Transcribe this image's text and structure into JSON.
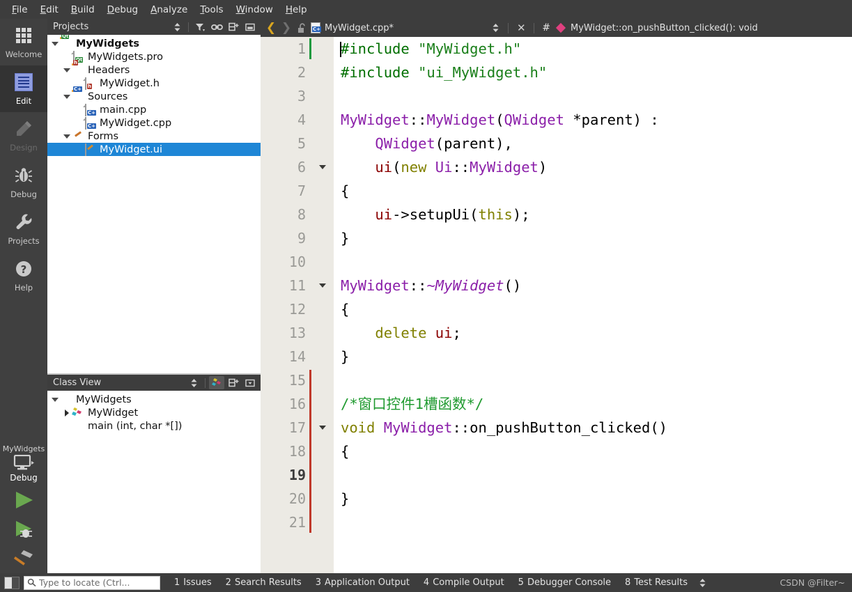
{
  "menubar": {
    "items": [
      {
        "label": "File",
        "mnemonic": "F"
      },
      {
        "label": "Edit",
        "mnemonic": "E"
      },
      {
        "label": "Build",
        "mnemonic": "B"
      },
      {
        "label": "Debug",
        "mnemonic": "D"
      },
      {
        "label": "Analyze",
        "mnemonic": "A"
      },
      {
        "label": "Tools",
        "mnemonic": "T"
      },
      {
        "label": "Window",
        "mnemonic": "W"
      },
      {
        "label": "Help",
        "mnemonic": "H"
      }
    ]
  },
  "modebar": {
    "modes": [
      {
        "label": "Welcome",
        "icon": "grid-icon",
        "state": "normal"
      },
      {
        "label": "Edit",
        "icon": "document-icon",
        "state": "active"
      },
      {
        "label": "Design",
        "icon": "pencil-icon",
        "state": "disabled"
      },
      {
        "label": "Debug",
        "icon": "bug-icon",
        "state": "normal"
      },
      {
        "label": "Projects",
        "icon": "wrench-icon",
        "state": "normal"
      },
      {
        "label": "Help",
        "icon": "question-mark-icon",
        "state": "normal"
      }
    ],
    "kit_selector": {
      "project": "MyWidgets",
      "build_config": "Debug",
      "icon": "monitor-icon"
    },
    "actions": [
      {
        "name": "run-button",
        "icon": "play-icon"
      },
      {
        "name": "debug-button",
        "icon": "play-bug-icon"
      },
      {
        "name": "build-button",
        "icon": "hammer-icon"
      }
    ]
  },
  "projects_panel": {
    "title": "Projects",
    "toolbar": [
      {
        "name": "sync-dropdown",
        "icon": "updown-arrows-icon"
      },
      {
        "name": "filter-tree-button",
        "icon": "funnel-icon"
      },
      {
        "name": "link-with-editor-button",
        "icon": "link-icon"
      },
      {
        "name": "split-button",
        "icon": "split-plus-icon"
      },
      {
        "name": "close-panel-button",
        "icon": "minimize-icon"
      }
    ],
    "tree": [
      {
        "label": "MyWidgets",
        "depth": 0,
        "expander": "down",
        "icon": "qt-project-folder-icon",
        "bold": true,
        "selected": false
      },
      {
        "label": "MyWidgets.pro",
        "depth": 1,
        "expander": "none",
        "icon": "qt-pro-file-icon",
        "bold": false,
        "selected": false
      },
      {
        "label": "Headers",
        "depth": 1,
        "expander": "down",
        "icon": "headers-folder-icon",
        "bold": false,
        "selected": false
      },
      {
        "label": "MyWidget.h",
        "depth": 2,
        "expander": "none",
        "icon": "header-file-icon",
        "bold": false,
        "selected": false
      },
      {
        "label": "Sources",
        "depth": 1,
        "expander": "down",
        "icon": "sources-folder-icon",
        "bold": false,
        "selected": false
      },
      {
        "label": "main.cpp",
        "depth": 2,
        "expander": "none",
        "icon": "cpp-file-icon",
        "bold": false,
        "selected": false
      },
      {
        "label": "MyWidget.cpp",
        "depth": 2,
        "expander": "none",
        "icon": "cpp-file-icon",
        "bold": false,
        "selected": false
      },
      {
        "label": "Forms",
        "depth": 1,
        "expander": "down",
        "icon": "forms-folder-icon",
        "bold": false,
        "selected": false
      },
      {
        "label": "MyWidget.ui",
        "depth": 2,
        "expander": "none",
        "icon": "ui-file-icon",
        "bold": false,
        "selected": true
      }
    ]
  },
  "class_view_panel": {
    "title": "Class View",
    "toolbar": [
      {
        "name": "sync-dropdown",
        "icon": "updown-arrows-icon"
      },
      {
        "name": "show-subprojects-button",
        "icon": "class-filter-icon",
        "active": true
      },
      {
        "name": "split-button",
        "icon": "split-plus-icon"
      },
      {
        "name": "panel-menu-button",
        "icon": "dropdown-box-icon"
      }
    ],
    "tree": [
      {
        "label": "MyWidgets",
        "depth": 0,
        "expander": "down",
        "icon": "project-folder-icon"
      },
      {
        "label": "MyWidget",
        "depth": 1,
        "expander": "right",
        "icon": "class-icon"
      },
      {
        "label": "main (int, char *[])",
        "depth": 1,
        "expander": "none",
        "icon": "function-diamond-icon"
      }
    ]
  },
  "editor": {
    "toolbar": {
      "back_icon": "chevron-left-icon",
      "forward_icon": "chevron-right-icon",
      "lock_icon": "unlocked-padlock-icon",
      "file_icon": "cpp-file-icon",
      "filename": "MyWidget.cpp*",
      "dropdown_icon": "updown-arrows-icon",
      "close_icon": "close-icon",
      "hash_icon": "#",
      "symbol_icon": "function-diamond-icon",
      "symbol": "MyWidget::on_pushButton_clicked(): void"
    },
    "current_line": 19,
    "lines": [
      {
        "n": 1,
        "fold": false,
        "mark": "green",
        "tokens": [
          {
            "t": "#include ",
            "c": "pp"
          },
          {
            "t": "\"MyWidget.h\"",
            "c": "st"
          }
        ]
      },
      {
        "n": 2,
        "fold": false,
        "mark": "none",
        "tokens": [
          {
            "t": "#include ",
            "c": "pp"
          },
          {
            "t": "\"ui_MyWidget.h\"",
            "c": "st"
          }
        ]
      },
      {
        "n": 3,
        "fold": false,
        "mark": "none",
        "tokens": []
      },
      {
        "n": 4,
        "fold": false,
        "mark": "none",
        "tokens": [
          {
            "t": "MyWidget",
            "c": "ty"
          },
          {
            "t": "::",
            "c": ""
          },
          {
            "t": "MyWidget",
            "c": "ty"
          },
          {
            "t": "(",
            "c": ""
          },
          {
            "t": "QWidget",
            "c": "ty"
          },
          {
            "t": " *parent) :",
            "c": ""
          }
        ]
      },
      {
        "n": 5,
        "fold": false,
        "mark": "none",
        "tokens": [
          {
            "t": "    ",
            "c": ""
          },
          {
            "t": "QWidget",
            "c": "ty"
          },
          {
            "t": "(parent),",
            "c": ""
          }
        ]
      },
      {
        "n": 6,
        "fold": true,
        "mark": "none",
        "tokens": [
          {
            "t": "    ",
            "c": ""
          },
          {
            "t": "ui",
            "c": "mb"
          },
          {
            "t": "(",
            "c": ""
          },
          {
            "t": "new",
            "c": "k"
          },
          {
            "t": " ",
            "c": ""
          },
          {
            "t": "Ui",
            "c": "ty"
          },
          {
            "t": "::",
            "c": ""
          },
          {
            "t": "MyWidget",
            "c": "ty"
          },
          {
            "t": ")",
            "c": ""
          }
        ]
      },
      {
        "n": 7,
        "fold": false,
        "mark": "none",
        "tokens": [
          {
            "t": "{",
            "c": ""
          }
        ]
      },
      {
        "n": 8,
        "fold": false,
        "mark": "none",
        "tokens": [
          {
            "t": "    ",
            "c": ""
          },
          {
            "t": "ui",
            "c": "mb"
          },
          {
            "t": "->setupUi(",
            "c": ""
          },
          {
            "t": "this",
            "c": "k"
          },
          {
            "t": ");",
            "c": ""
          }
        ]
      },
      {
        "n": 9,
        "fold": false,
        "mark": "none",
        "tokens": [
          {
            "t": "}",
            "c": ""
          }
        ]
      },
      {
        "n": 10,
        "fold": false,
        "mark": "none",
        "tokens": []
      },
      {
        "n": 11,
        "fold": true,
        "mark": "none",
        "tokens": [
          {
            "t": "MyWidget",
            "c": "ty"
          },
          {
            "t": "::",
            "c": ""
          },
          {
            "t": "~MyWidget",
            "c": "ty-i"
          },
          {
            "t": "()",
            "c": ""
          }
        ]
      },
      {
        "n": 12,
        "fold": false,
        "mark": "none",
        "tokens": [
          {
            "t": "{",
            "c": ""
          }
        ]
      },
      {
        "n": 13,
        "fold": false,
        "mark": "none",
        "tokens": [
          {
            "t": "    ",
            "c": ""
          },
          {
            "t": "delete",
            "c": "k"
          },
          {
            "t": " ",
            "c": ""
          },
          {
            "t": "ui",
            "c": "mb"
          },
          {
            "t": ";",
            "c": ""
          }
        ]
      },
      {
        "n": 14,
        "fold": false,
        "mark": "none",
        "tokens": [
          {
            "t": "}",
            "c": ""
          }
        ]
      },
      {
        "n": 15,
        "fold": false,
        "mark": "red",
        "tokens": []
      },
      {
        "n": 16,
        "fold": false,
        "mark": "red",
        "tokens": [
          {
            "t": "/*窗口控件1槽函数*/",
            "c": "cm"
          }
        ]
      },
      {
        "n": 17,
        "fold": true,
        "mark": "red",
        "tokens": [
          {
            "t": "void",
            "c": "k"
          },
          {
            "t": " ",
            "c": ""
          },
          {
            "t": "MyWidget",
            "c": "ty"
          },
          {
            "t": "::on_pushButton_clicked()",
            "c": ""
          }
        ]
      },
      {
        "n": 18,
        "fold": false,
        "mark": "red",
        "tokens": [
          {
            "t": "{",
            "c": ""
          }
        ]
      },
      {
        "n": 19,
        "fold": false,
        "mark": "red",
        "tokens": []
      },
      {
        "n": 20,
        "fold": false,
        "mark": "red",
        "tokens": [
          {
            "t": "}",
            "c": ""
          }
        ]
      },
      {
        "n": 21,
        "fold": false,
        "mark": "red",
        "tokens": []
      }
    ]
  },
  "statusbar": {
    "toggle_sidebar_icon": "toggle-sidebar-icon",
    "locator": {
      "icon": "search-icon",
      "placeholder": "Type to locate (Ctrl..."
    },
    "panes": [
      {
        "num": "1",
        "label": "Issues"
      },
      {
        "num": "2",
        "label": "Search Results"
      },
      {
        "num": "3",
        "label": "Application Output"
      },
      {
        "num": "4",
        "label": "Compile Output"
      },
      {
        "num": "5",
        "label": "Debugger Console"
      },
      {
        "num": "8",
        "label": "Test Results"
      }
    ],
    "expand_icon": "updown-arrows-icon",
    "watermark": "CSDN @Filter~"
  },
  "colors": {
    "chrome": "#3d3d3d",
    "modebar": "#404040",
    "selection": "#1e86d6",
    "gutter": "#eceae4",
    "modified_marker": "#c0392b",
    "saved_marker": "#1f9a3f",
    "keyword": "#808000",
    "string": "#1a7f1a",
    "type": "#8b1fa9",
    "comment": "#1f9a2f",
    "member": "#8b0000",
    "preprocessor": "#006f00"
  }
}
